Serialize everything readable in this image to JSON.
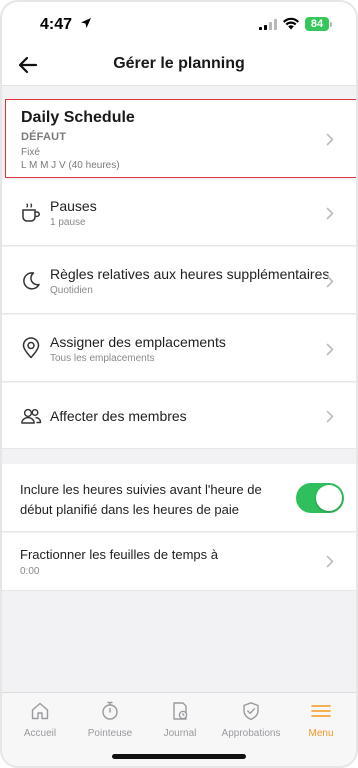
{
  "status_bar": {
    "time": "4:47",
    "battery": "84"
  },
  "header": {
    "title": "Gérer le planning"
  },
  "schedule": {
    "name": "Daily Schedule",
    "tag": "DÉFAUT",
    "type": "Fixé",
    "days": "L M M J V (40 heures)"
  },
  "rows": [
    {
      "title": "Pauses",
      "subtitle": "1 pause",
      "icon": "coffee-cup-icon"
    },
    {
      "title": "Règles relatives aux heures supplémentaires",
      "subtitle": "Quotidien",
      "icon": "moon-icon"
    },
    {
      "title": "Assigner des emplacements",
      "subtitle": "Tous les emplacements",
      "icon": "location-pin-icon"
    },
    {
      "title": "Affecter des membres",
      "subtitle": "",
      "icon": "people-icon"
    }
  ],
  "toggle_setting": {
    "label": "Inclure les heures suivies avant l'heure de début planifié dans les heures de paie",
    "enabled": true
  },
  "split_timesheets": {
    "title": "Fractionner les feuilles de temps à",
    "value": "0:00"
  },
  "tabs": [
    {
      "label": "Accueil",
      "icon": "home-icon"
    },
    {
      "label": "Pointeuse",
      "icon": "stopwatch-icon"
    },
    {
      "label": "Journal",
      "icon": "timesheet-icon"
    },
    {
      "label": "Approbations",
      "icon": "shield-check-icon"
    },
    {
      "label": "Menu",
      "icon": "hamburger-menu-icon",
      "active": true
    }
  ],
  "colors": {
    "accent": "#f7961e",
    "toggle_on": "#2fbf5c",
    "highlight_border": "#e0353f"
  }
}
